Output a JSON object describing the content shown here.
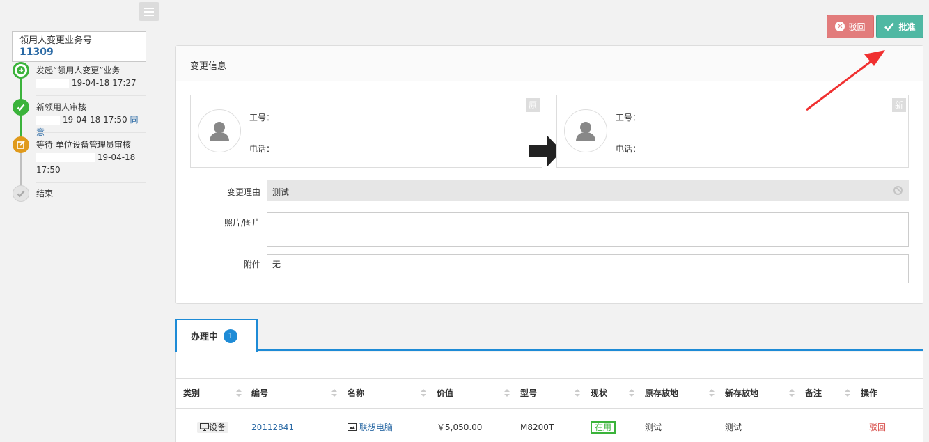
{
  "sidebar": {
    "biz_label": "领用人变更业务号",
    "biz_number": "11309",
    "steps": [
      {
        "title": "发起“领用人变更”业务",
        "time": "19-04-18 17:27",
        "result": ""
      },
      {
        "title": "新领用人审核",
        "time": "19-04-18 17:50",
        "result": "同意"
      },
      {
        "title": "等待 单位设备管理员审核",
        "time": "19-04-18",
        "time2": "17:50",
        "result": ""
      },
      {
        "title": "结束",
        "time": "",
        "result": ""
      }
    ]
  },
  "actions": {
    "reject_label": "驳回",
    "approve_label": "批准"
  },
  "card": {
    "title": "变更信息",
    "original": {
      "tag": "原",
      "id_label": "工号：",
      "phone_label": "电话："
    },
    "new": {
      "tag": "新",
      "id_label": "工号：",
      "phone_label": "电话："
    },
    "reason_label": "变更理由",
    "reason_value": "测试",
    "photo_label": "照片/图片",
    "attachment_label": "附件",
    "attachment_value": "无"
  },
  "tab": {
    "label": "办理中",
    "count": "1"
  },
  "table": {
    "headers": [
      "类别",
      "编号",
      "名称",
      "价值",
      "型号",
      "现状",
      "原存放地",
      "新存放地",
      "备注",
      "操作"
    ],
    "rows": [
      {
        "category": "设备",
        "number": "20112841",
        "name": "联想电脑",
        "value": "￥5,050.00",
        "model": "M8200T",
        "status": "在用",
        "old_location": "测试",
        "new_location": "测试",
        "remark": "",
        "action": "驳回"
      }
    ]
  },
  "colors": {
    "accent": "#1e8bd6",
    "approve": "#4fb8a3",
    "reject": "#e27c7c",
    "done": "#3bb33b",
    "pending": "#e09a1b"
  }
}
